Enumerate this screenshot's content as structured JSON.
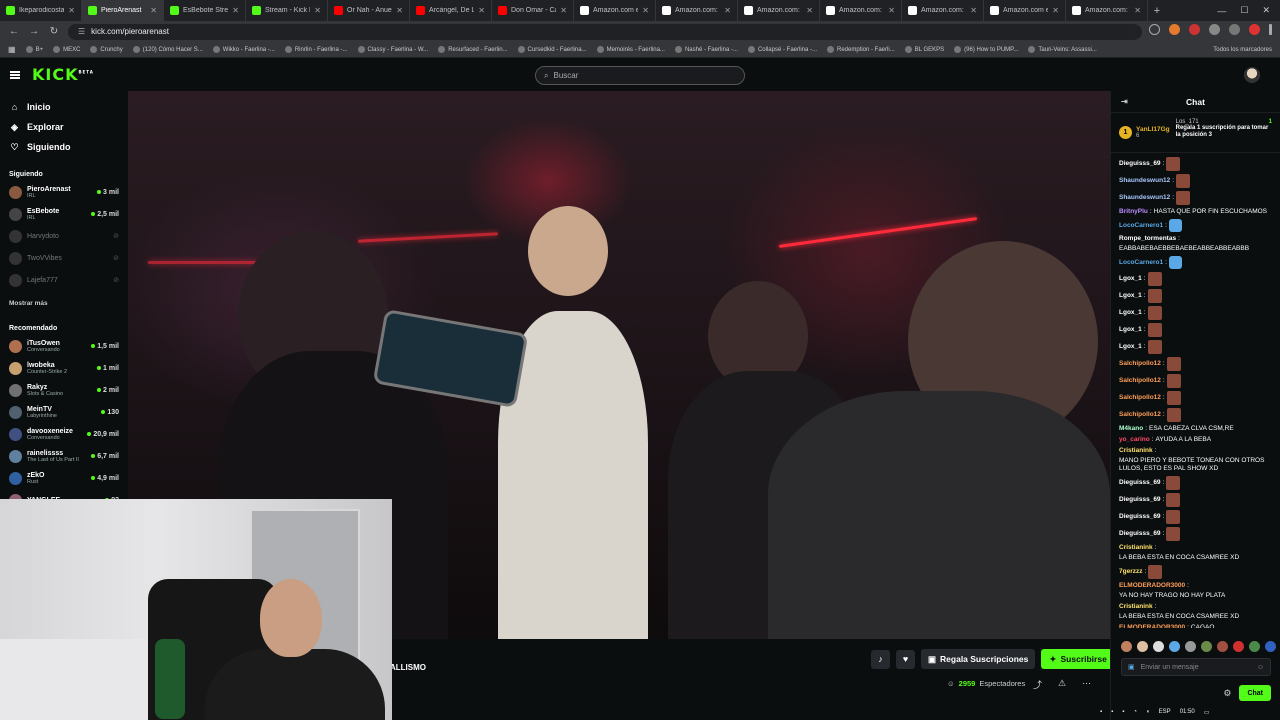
{
  "browser": {
    "tabs": [
      {
        "label": "Ikeparodicosta St",
        "color": "#53fc18",
        "active": false
      },
      {
        "label": "PieroArenast",
        "color": "#53fc18",
        "active": true
      },
      {
        "label": "EsBebote Stream",
        "color": "#53fc18",
        "active": false
      },
      {
        "label": "Stream - Kick Da",
        "color": "#53fc18",
        "active": false
      },
      {
        "label": "Or Nah - Anuel A",
        "color": "#ff0000",
        "active": false
      },
      {
        "label": "Arcángel, De La G",
        "color": "#ff0000",
        "active": false
      },
      {
        "label": "Don Omar - Cara",
        "color": "#ff0000",
        "active": false
      },
      {
        "label": "Amazon.com en",
        "color": "#ffffff",
        "active": false
      },
      {
        "label": "Amazon.com: Ra",
        "color": "#ffffff",
        "active": false
      },
      {
        "label": "Amazon.com: Ra",
        "color": "#ffffff",
        "active": false
      },
      {
        "label": "Amazon.com: Elg",
        "color": "#ffffff",
        "active": false
      },
      {
        "label": "Amazon.com: Ra",
        "color": "#ffffff",
        "active": false
      },
      {
        "label": "Amazon.com en",
        "color": "#ffffff",
        "active": false
      },
      {
        "label": "Amazon.com: Ve",
        "color": "#ffffff",
        "active": false
      }
    ],
    "url": "kick.com/pieroarenast",
    "bookmarks": [
      "B+",
      "MEXC",
      "Crunchy",
      "(120) Cómo Hacer S...",
      "Wikko - Faerlina -...",
      "Rinrlin - Faerlina -...",
      "Classy - Faerlina - W...",
      "Resurfaced - Faerlin...",
      "Cursedkid - Faerlina...",
      "Memoirés - Faerlina...",
      "Nashé - Faerlina -...",
      "Collapsé - Faerlina -...",
      "Redemption - Faerli...",
      "BL GEKPS",
      "(96) How to PUMP...",
      "Tauri-Veins: Assassi..."
    ],
    "bookmarks_right": "Todos los marcadores"
  },
  "header": {
    "logo": "KICK",
    "logo_beta": "BETA",
    "search_placeholder": "Buscar"
  },
  "sidebar": {
    "nav": [
      {
        "label": "Inicio",
        "icon": "home-icon",
        "glyph": "⌂"
      },
      {
        "label": "Explorar",
        "icon": "compass-icon",
        "glyph": "◈"
      },
      {
        "label": "Siguiendo",
        "icon": "heart-icon",
        "glyph": "♡"
      }
    ],
    "following_title": "Siguiendo",
    "following": [
      {
        "name": "PieroArenast",
        "category": "IRL",
        "viewers": "3 mil",
        "live": true,
        "color": "#8a5a40"
      },
      {
        "name": "EsBebote",
        "category": "IRL",
        "viewers": "2,5 mil",
        "live": true,
        "color": "#444"
      },
      {
        "name": "Harvydoto",
        "category": "",
        "viewers": "",
        "live": false,
        "color": "#333"
      },
      {
        "name": "TwoVVibes",
        "category": "",
        "viewers": "",
        "live": false,
        "color": "#333"
      },
      {
        "name": "Lajefa777",
        "category": "",
        "viewers": "",
        "live": false,
        "color": "#333"
      }
    ],
    "show_more": "Mostrar más",
    "recommended_title": "Recomendado",
    "recommended": [
      {
        "name": "iTusOwen",
        "category": "Conversando",
        "viewers": "1,5 mil",
        "color": "#b07050"
      },
      {
        "name": "lwobeka",
        "category": "Counter-Strike 2",
        "viewers": "1 mil",
        "color": "#c8a070"
      },
      {
        "name": "Rakyz",
        "category": "Slots & Casino",
        "viewers": "2 mil",
        "color": "#707070"
      },
      {
        "name": "MeinTV",
        "category": "Labyrinthine",
        "viewers": "130",
        "color": "#506070"
      },
      {
        "name": "davooxeneize",
        "category": "Conversando",
        "viewers": "20,9 mil",
        "color": "#405080"
      },
      {
        "name": "rainelissss",
        "category": "The Last of Us Part II",
        "viewers": "6,7 mil",
        "color": "#6080a0"
      },
      {
        "name": "zEkO",
        "category": "Rust",
        "viewers": "4,9 mil",
        "color": "#3060a0"
      },
      {
        "name": "YANGLEE",
        "category": "",
        "viewers": "93",
        "color": "#906070"
      }
    ]
  },
  "stream": {
    "title_snippet": "ALLISMO",
    "viewers_count": "2959",
    "viewers_label": "Espectadores",
    "gift_label": "Regala Suscripciones",
    "subscribe_label": "Suscribirse"
  },
  "chat": {
    "title": "Chat",
    "pinned_user": "YanLl17Gg",
    "pinned_count": "6",
    "pinned_user2": "Los_171",
    "pinned_text": "Regala 1 suscripción para tomar la posición 3",
    "pinned_count2": "1",
    "input_placeholder": "Enviar un mensaje",
    "send_label": "Chat",
    "messages": [
      {
        "user": "Dieguisss_69",
        "text": "",
        "color": "#ffffff",
        "emote": true
      },
      {
        "user": "Shaundeswun12",
        "text": "",
        "color": "#a8c8ff",
        "emote": true
      },
      {
        "user": "Shaundeswun12",
        "text": "",
        "color": "#a8c8ff",
        "emote": true
      },
      {
        "user": "BritnyPlu",
        "text": "HASTA QUE POR FIN ESCUCHAMOS",
        "color": "#b98cff",
        "emote": false
      },
      {
        "user": "LocoCarnero1",
        "text": "",
        "color": "#5aa9e6",
        "emote": true
      },
      {
        "user": "Rompe_tormentas",
        "text": "EABBABEBAEBBEBAEBEABBEABBEABBB",
        "color": "#ffffff",
        "emote": false
      },
      {
        "user": "LocoCarnero1",
        "text": "",
        "color": "#5aa9e6",
        "emote": true
      },
      {
        "user": "Lgox_1",
        "text": "",
        "color": "#ffffff",
        "emote": true
      },
      {
        "user": "Lgox_1",
        "text": "",
        "color": "#ffffff",
        "emote": true
      },
      {
        "user": "Lgox_1",
        "text": "",
        "color": "#ffffff",
        "emote": true
      },
      {
        "user": "Lgox_1",
        "text": "",
        "color": "#ffffff",
        "emote": true
      },
      {
        "user": "Lgox_1",
        "text": "",
        "color": "#ffffff",
        "emote": true
      },
      {
        "user": "Salchipollo12",
        "text": "",
        "color": "#ff9f5a",
        "emote": true
      },
      {
        "user": "Salchipollo12",
        "text": "",
        "color": "#ff9f5a",
        "emote": true
      },
      {
        "user": "Salchipollo12",
        "text": "",
        "color": "#ff9f5a",
        "emote": true
      },
      {
        "user": "Salchipollo12",
        "text": "",
        "color": "#ff9f5a",
        "emote": true
      },
      {
        "user": "M4kano",
        "text": "ESA CABEZA CLVA CSM,RE",
        "color": "#a8ffcf",
        "emote": false
      },
      {
        "user": "yo_carino",
        "text": "AYUDA A LA BEBA",
        "color": "#ff4a6a",
        "emote": false
      },
      {
        "user": "Cristianink",
        "text": "MANO PIERO Y BEBOTE TONEAN CON OTROS LULOS, ESTO ES PAL SHOW XD",
        "color": "#ffe36a",
        "emote": false
      },
      {
        "user": "Dieguisss_69",
        "text": "",
        "color": "#ffffff",
        "emote": true
      },
      {
        "user": "Dieguisss_69",
        "text": "",
        "color": "#ffffff",
        "emote": true
      },
      {
        "user": "Dieguisss_69",
        "text": "",
        "color": "#ffffff",
        "emote": true
      },
      {
        "user": "Dieguisss_69",
        "text": "",
        "color": "#ffffff",
        "emote": true
      },
      {
        "user": "Cristianink",
        "text": "LA BEBA ESTA EN COCA CSAMREE XD",
        "color": "#ffe36a",
        "emote": false
      },
      {
        "user": "7gerzzz",
        "text": "",
        "color": "#ffe36a",
        "emote": true
      },
      {
        "user": "ELMODERADOR3000",
        "text": "YA NO HAY TRAGO NO HAY PLATA",
        "color": "#ff9f5a",
        "emote": false
      },
      {
        "user": "Cristianink",
        "text": "LA BEBA ESTA EN COCA CSAMREE XD",
        "color": "#ffe36a",
        "emote": false
      },
      {
        "user": "ELMODERADOR3000",
        "text": "CAGAO",
        "color": "#ff9f5a",
        "emote": false
      }
    ]
  },
  "taskbar": {
    "lang": "ESP",
    "time": "01:50"
  },
  "colors": {
    "accent": "#53fc18",
    "bg": "#0b0e0f"
  }
}
